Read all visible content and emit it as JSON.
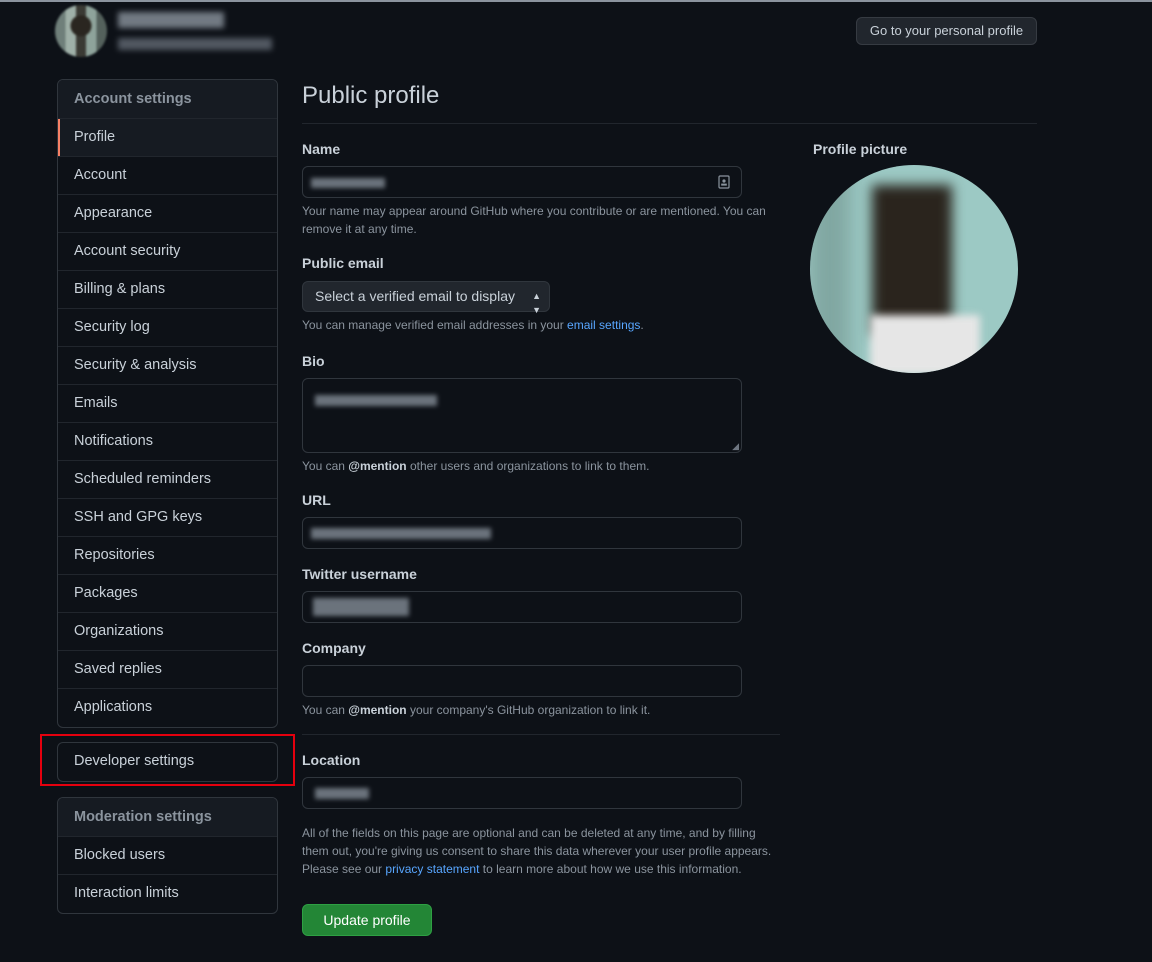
{
  "header": {
    "go_to_profile_button": "Go to your personal profile"
  },
  "sidebar": {
    "account_settings_heading": "Account settings",
    "items": [
      {
        "label": "Profile"
      },
      {
        "label": "Account"
      },
      {
        "label": "Appearance"
      },
      {
        "label": "Account security"
      },
      {
        "label": "Billing & plans"
      },
      {
        "label": "Security log"
      },
      {
        "label": "Security & analysis"
      },
      {
        "label": "Emails"
      },
      {
        "label": "Notifications"
      },
      {
        "label": "Scheduled reminders"
      },
      {
        "label": "SSH and GPG keys"
      },
      {
        "label": "Repositories"
      },
      {
        "label": "Packages"
      },
      {
        "label": "Organizations"
      },
      {
        "label": "Saved replies"
      },
      {
        "label": "Applications"
      }
    ],
    "developer_settings": "Developer settings",
    "moderation_heading": "Moderation settings",
    "moderation_items": [
      {
        "label": "Blocked users"
      },
      {
        "label": "Interaction limits"
      }
    ]
  },
  "main": {
    "title": "Public profile",
    "name": {
      "label": "Name",
      "note": "Your name may appear around GitHub where you contribute or are mentioned. You can remove it at any time."
    },
    "public_email": {
      "label": "Public email",
      "selected": "Select a verified email to display",
      "note_prefix": "You can manage verified email addresses in your ",
      "note_link": "email settings",
      "note_suffix": "."
    },
    "bio": {
      "label": "Bio",
      "note_prefix": "You can ",
      "note_mention": "@mention",
      "note_suffix": " other users and organizations to link to them."
    },
    "url": {
      "label": "URL"
    },
    "twitter": {
      "label": "Twitter username"
    },
    "company": {
      "label": "Company",
      "note_prefix": "You can ",
      "note_mention": "@mention",
      "note_suffix": " your company's GitHub organization to link it."
    },
    "location": {
      "label": "Location"
    },
    "footer_note_prefix": "All of the fields on this page are optional and can be deleted at any time, and by filling them out, you're giving us consent to share this data wherever your user profile appears. Please see our ",
    "footer_note_link": "privacy statement",
    "footer_note_suffix": " to learn more about how we use this information.",
    "update_button": "Update profile"
  },
  "profile_picture": {
    "label": "Profile picture"
  },
  "colors": {
    "background": "#0d1117",
    "accent_selected": "#f78166",
    "link": "#58a6ff",
    "primary_button": "#238636",
    "highlight_box": "#e5000e"
  }
}
